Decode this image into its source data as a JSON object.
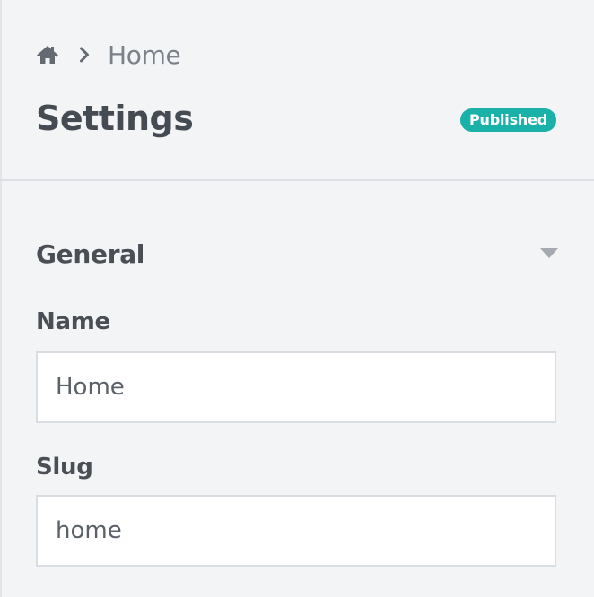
{
  "breadcrumb": {
    "home_icon": "home-icon",
    "separator_icon": "chevron-right-icon",
    "current": "Home"
  },
  "header": {
    "title": "Settings",
    "status": "Published",
    "status_color": "#19b1a8"
  },
  "section": {
    "title": "General",
    "toggle_icon": "caret-down-icon"
  },
  "fields": {
    "name": {
      "label": "Name",
      "value": "Home"
    },
    "slug": {
      "label": "Slug",
      "value": "home"
    }
  }
}
